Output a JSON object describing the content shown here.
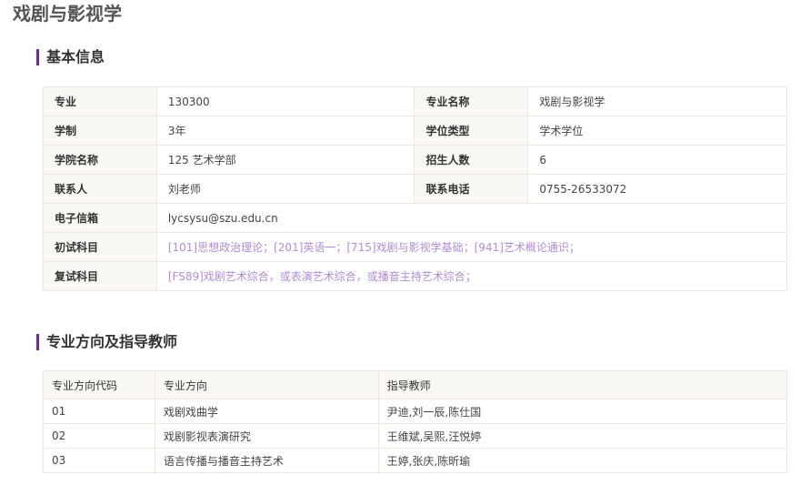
{
  "page_title": "戏剧与影视学",
  "basic_info": {
    "section_title": "基本信息",
    "major_code_label": "专业",
    "major_code": "130300",
    "major_name_label": "专业名称",
    "major_name": "戏剧与影视学",
    "duration_label": "学制",
    "duration": "3年",
    "degree_type_label": "学位类型",
    "degree_type": "学术学位",
    "college_label": "学院名称",
    "college": "125 艺术学部",
    "enrollment_label": "招生人数",
    "enrollment": "6",
    "contact_label": "联系人",
    "contact": "刘老师",
    "phone_label": "联系电话",
    "phone": "0755-26533072",
    "email_label": "电子信箱",
    "email": "lycsysu@szu.edu.cn",
    "initial_exam_label": "初试科目",
    "initial_exam": "[101]思想政治理论；[201]英语一；[715]戏剧与影视学基础；[941]艺术概论通识；",
    "retest_label": "复试科目",
    "retest": "[FS89]戏剧艺术综合，或表演艺术综合，或播音主持艺术综合；"
  },
  "directions": {
    "section_title": "专业方向及指导教师",
    "headers": [
      "专业方向代码",
      "专业方向",
      "指导教师"
    ],
    "rows": [
      [
        "01",
        "戏剧戏曲学",
        "尹迪,刘一辰,陈仕国"
      ],
      [
        "02",
        "戏剧影视表演研究",
        "王维斌,吴熙,汪悦婷"
      ],
      [
        "03",
        "语言传播与播音主持艺术",
        "王婷,张庆,陈昕瑜"
      ]
    ]
  },
  "colors": {
    "accent_bar": "#6a2c8e",
    "exam_text": "#b28ad1",
    "label_bg": "#faf8f5",
    "border": "#efe6dc"
  }
}
